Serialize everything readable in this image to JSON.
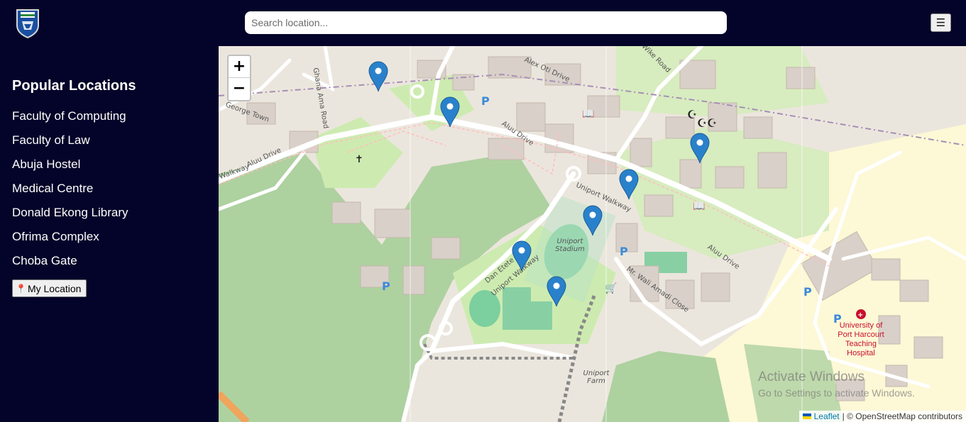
{
  "header": {
    "search_placeholder": "Search location...",
    "menu_icon": "☰"
  },
  "sidebar": {
    "title": "Popular Locations",
    "items": [
      {
        "label": "Faculty of Computing"
      },
      {
        "label": "Faculty of Law"
      },
      {
        "label": "Abuja Hostel"
      },
      {
        "label": "Medical Centre"
      },
      {
        "label": "Donald Ekong Library"
      },
      {
        "label": "Ofrima Complex"
      },
      {
        "label": "Choba Gate"
      }
    ],
    "my_location_icon": "📍",
    "my_location_label": "My Location"
  },
  "map": {
    "zoom_in": "+",
    "zoom_out": "−",
    "road_labels": {
      "alex_oti": "Alex Oti Drive",
      "aluu_drive_1": "Aluu Drive",
      "aluu_drive_2": "Aluu Drive",
      "uniport_walkway": "Uniport Walkway",
      "uniport_walkway_2": "Uniport Walkway",
      "ghana_ama": "Ghana Ama Road",
      "george_town": "George Town",
      "wike_road": "Wike Road",
      "wali_amadi": "Mr. Wali Amadi Close",
      "dan_etete": "Dan Etete Road",
      "uniport_stadium": "Uniport Stadium",
      "uniport_farm": "Uniport Farm",
      "walkway_left": "Walkway",
      "aluu_left": "Aluu Drive"
    },
    "hospital_label": "University of Port Harcourt Teaching Hospital",
    "attribution_leaflet": "Leaflet",
    "attribution_osm": "| © OpenStreetMap contributors",
    "watermark_line1": "Activate Windows",
    "watermark_line2": "Go to Settings to activate Windows.",
    "marker_color": "#2a81cb"
  }
}
